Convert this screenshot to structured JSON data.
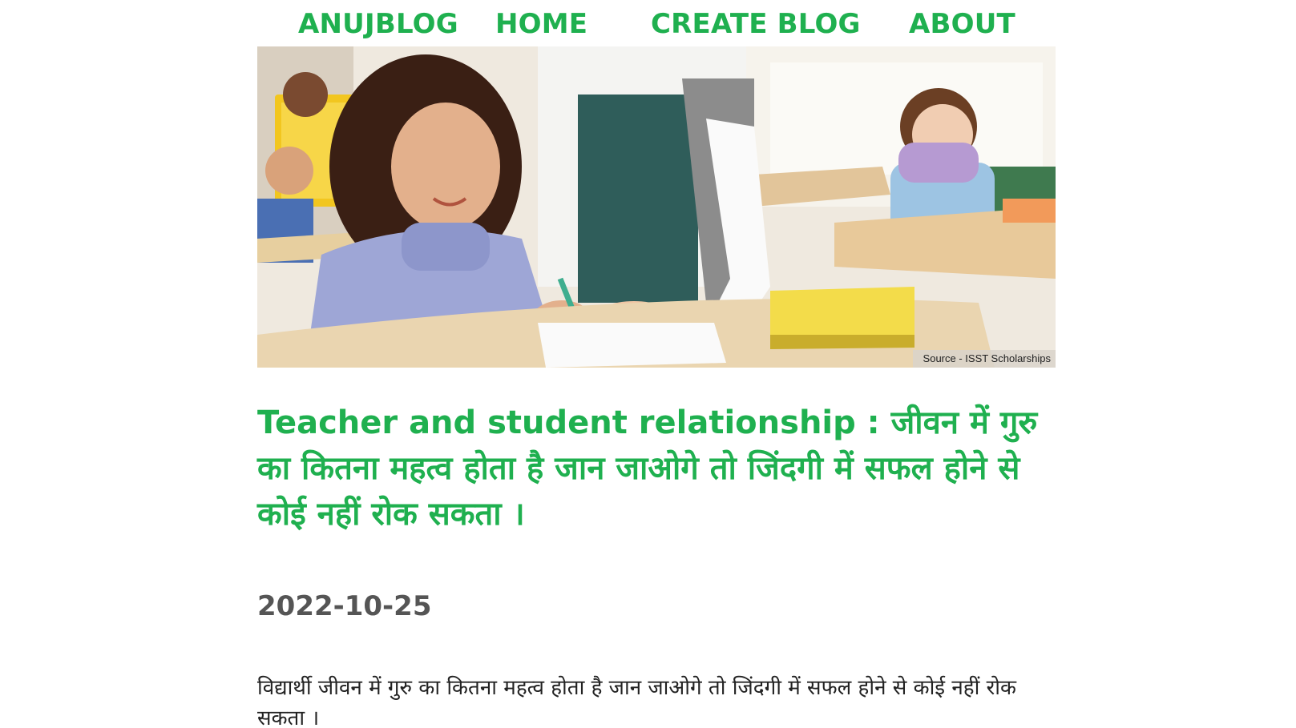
{
  "nav": {
    "brand": "ANUJBLOG",
    "home": "HOME",
    "create_blog": "CREATE BLOG",
    "about": "ABOUT"
  },
  "hero": {
    "source_caption": "Source - ISST Scholarships"
  },
  "post": {
    "title": "Teacher and student relationship : जीवन में गुरु का कितना महत्व होता है जान जाओगे तो जिंदगी में सफल होने से कोई नहीं रोक सकता ।",
    "date": "2022-10-25",
    "body": "विद्यार्थी जीवन में गुरु का कितना महत्व होता है जान जाओगे तो जिंदगी में सफल होने से कोई नहीं रोक सकता ।"
  },
  "colors": {
    "accent": "#1fb04f",
    "date": "#555555",
    "text": "#222222"
  }
}
